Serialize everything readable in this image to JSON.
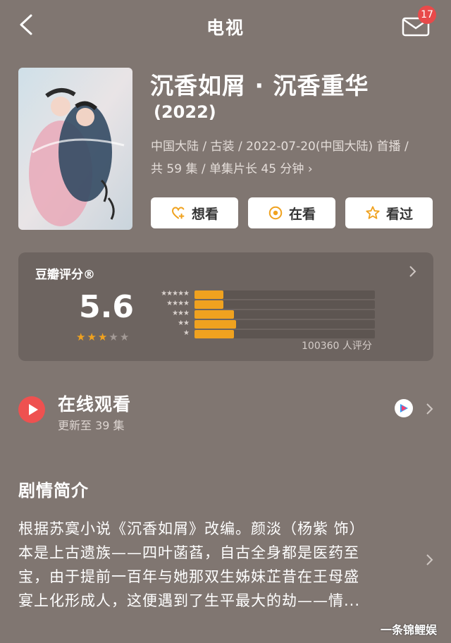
{
  "header": {
    "title": "电视",
    "mail_badge": "17",
    "icons": [
      "back-arrow-icon",
      "mail-icon"
    ]
  },
  "show": {
    "title": "沉香如屑 · 沉香重华",
    "year": "(2022)",
    "meta_line1": "中国大陆 / 古装 / 2022-07-20(中国大陆) 首播 /",
    "meta_line2": "共 59 集 / 单集片长 45 分钟 ›"
  },
  "actions": {
    "want_label": "想看",
    "watching_label": "在看",
    "watched_label": "看过"
  },
  "rating": {
    "label": "豆瓣评分®",
    "score": "5.6",
    "stars": 2.8,
    "distribution": [
      {
        "stars": "★★★★★",
        "percent": 16
      },
      {
        "stars": "★★★★",
        "percent": 16
      },
      {
        "stars": "★★★",
        "percent": 22
      },
      {
        "stars": "★★",
        "percent": 23
      },
      {
        "stars": "★",
        "percent": 22
      }
    ],
    "votes": "100360 人评分",
    "colors": {
      "accent": "#f0a21f"
    }
  },
  "online": {
    "title": "在线观看",
    "subtitle": "更新至 39 集",
    "provider_icon": "youku-icon"
  },
  "synopsis": {
    "title": "剧情简介",
    "lines": [
      "根据苏寞小说《沉香如屑》改编。颜淡（杨紫 饰）",
      "本是上古遗族——四叶菡萏，自古全身都是医药至",
      "宝，由于提前一百年与她那双生姊妹芷昔在王母盛",
      "宴上化形成人，这便遇到了生平最大的劫——情..."
    ]
  },
  "watermark": "一条锦鲤娱"
}
